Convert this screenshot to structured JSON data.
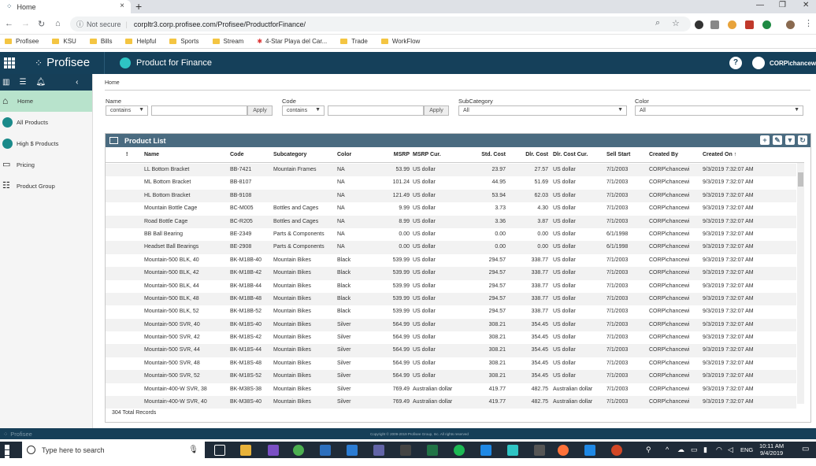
{
  "browser": {
    "tab_title": "Home",
    "security_label": "Not secure",
    "url": "corpltr3.corp.profisee.com/Profisee/ProductforFinance/",
    "bookmarks": [
      "Profisee",
      "KSU",
      "Bills",
      "Helpful",
      "Sports",
      "Stream",
      "4-Star Playa del Car...",
      "Trade",
      "WorkFlow"
    ]
  },
  "app": {
    "brand": "Profisee",
    "app_name": "Product for Finance",
    "help": "?",
    "user": "CORP\\chancewi"
  },
  "sidebar": {
    "items": [
      {
        "label": "Home"
      },
      {
        "label": "All Products"
      },
      {
        "label": "High $ Products"
      },
      {
        "label": "Pricing"
      },
      {
        "label": "Product Group"
      }
    ]
  },
  "breadcrumb": "Home",
  "filters": {
    "name": {
      "label": "Name",
      "op": "contains",
      "apply": "Apply"
    },
    "code": {
      "label": "Code",
      "op": "contains",
      "apply": "Apply"
    },
    "subcategory": {
      "label": "SubCategory",
      "value": "All"
    },
    "color": {
      "label": "Color",
      "value": "All"
    }
  },
  "list": {
    "title": "Product List",
    "columns": {
      "flag": "!",
      "name": "Name",
      "code": "Code",
      "subcategory": "Subcategory",
      "color": "Color",
      "msrp": "MSRP",
      "msrp_cur": "MSRP Cur.",
      "std_cost": "Std. Cost",
      "dlr_cost": "Dlr. Cost",
      "dlr_cost_cur": "Dlr. Cost Cur.",
      "sell_start": "Sell Start",
      "created_by": "Created By",
      "created_on": "Created On"
    },
    "rows": [
      [
        "LL Bottom Bracket",
        "BB-7421",
        "Mountain Frames",
        "NA",
        "53.99",
        "US dollar",
        "23.97",
        "27.57",
        "US dollar",
        "7/1/2003",
        "CORP\\chancewi",
        "9/3/2019 7:32:07 AM"
      ],
      [
        "ML Bottom Bracket",
        "BB-8107",
        "",
        "NA",
        "101.24",
        "US dollar",
        "44.95",
        "51.69",
        "US dollar",
        "7/1/2003",
        "CORP\\chancewi",
        "9/3/2019 7:32:07 AM"
      ],
      [
        "HL Bottom Bracket",
        "BB-9108",
        "",
        "NA",
        "121.49",
        "US dollar",
        "53.94",
        "62.03",
        "US dollar",
        "7/1/2003",
        "CORP\\chancewi",
        "9/3/2019 7:32:07 AM"
      ],
      [
        "Mountain Bottle Cage",
        "BC-M005",
        "Bottles and Cages",
        "NA",
        "9.99",
        "US dollar",
        "3.73",
        "4.30",
        "US dollar",
        "7/1/2003",
        "CORP\\chancewi",
        "9/3/2019 7:32:07 AM"
      ],
      [
        "Road Bottle Cage",
        "BC-R205",
        "Bottles and Cages",
        "NA",
        "8.99",
        "US dollar",
        "3.36",
        "3.87",
        "US dollar",
        "7/1/2003",
        "CORP\\chancewi",
        "9/3/2019 7:32:07 AM"
      ],
      [
        "BB Ball Bearing",
        "BE-2349",
        "Parts & Components",
        "NA",
        "0.00",
        "US dollar",
        "0.00",
        "0.00",
        "US dollar",
        "6/1/1998",
        "CORP\\chancewi",
        "9/3/2019 7:32:07 AM"
      ],
      [
        "Headset Ball Bearings",
        "BE-2908",
        "Parts & Components",
        "NA",
        "0.00",
        "US dollar",
        "0.00",
        "0.00",
        "US dollar",
        "6/1/1998",
        "CORP\\chancewi",
        "9/3/2019 7:32:07 AM"
      ],
      [
        "Mountain-500 BLK, 40",
        "BK-M18B-40",
        "Mountain Bikes",
        "Black",
        "539.99",
        "US dollar",
        "294.57",
        "338.77",
        "US dollar",
        "7/1/2003",
        "CORP\\chancewi",
        "9/3/2019 7:32:07 AM"
      ],
      [
        "Mountain-500 BLK, 42",
        "BK-M18B-42",
        "Mountain Bikes",
        "Black",
        "539.99",
        "US dollar",
        "294.57",
        "338.77",
        "US dollar",
        "7/1/2003",
        "CORP\\chancewi",
        "9/3/2019 7:32:07 AM"
      ],
      [
        "Mountain-500 BLK, 44",
        "BK-M18B-44",
        "Mountain Bikes",
        "Black",
        "539.99",
        "US dollar",
        "294.57",
        "338.77",
        "US dollar",
        "7/1/2003",
        "CORP\\chancewi",
        "9/3/2019 7:32:07 AM"
      ],
      [
        "Mountain-500 BLK, 48",
        "BK-M18B-48",
        "Mountain Bikes",
        "Black",
        "539.99",
        "US dollar",
        "294.57",
        "338.77",
        "US dollar",
        "7/1/2003",
        "CORP\\chancewi",
        "9/3/2019 7:32:07 AM"
      ],
      [
        "Mountain-500 BLK, 52",
        "BK-M18B-52",
        "Mountain Bikes",
        "Black",
        "539.99",
        "US dollar",
        "294.57",
        "338.77",
        "US dollar",
        "7/1/2003",
        "CORP\\chancewi",
        "9/3/2019 7:32:07 AM"
      ],
      [
        "Mountain-500 SVR, 40",
        "BK-M18S-40",
        "Mountain Bikes",
        "Silver",
        "564.99",
        "US dollar",
        "308.21",
        "354.45",
        "US dollar",
        "7/1/2003",
        "CORP\\chancewi",
        "9/3/2019 7:32:07 AM"
      ],
      [
        "Mountain-500 SVR, 42",
        "BK-M18S-42",
        "Mountain Bikes",
        "Silver",
        "564.99",
        "US dollar",
        "308.21",
        "354.45",
        "US dollar",
        "7/1/2003",
        "CORP\\chancewi",
        "9/3/2019 7:32:07 AM"
      ],
      [
        "Mountain-500 SVR, 44",
        "BK-M18S-44",
        "Mountain Bikes",
        "Silver",
        "564.99",
        "US dollar",
        "308.21",
        "354.45",
        "US dollar",
        "7/1/2003",
        "CORP\\chancewi",
        "9/3/2019 7:32:07 AM"
      ],
      [
        "Mountain-500 SVR, 48",
        "BK-M18S-48",
        "Mountain Bikes",
        "Silver",
        "564.99",
        "US dollar",
        "308.21",
        "354.45",
        "US dollar",
        "7/1/2003",
        "CORP\\chancewi",
        "9/3/2019 7:32:07 AM"
      ],
      [
        "Mountain-500 SVR, 52",
        "BK-M18S-52",
        "Mountain Bikes",
        "Silver",
        "564.99",
        "US dollar",
        "308.21",
        "354.45",
        "US dollar",
        "7/1/2003",
        "CORP\\chancewi",
        "9/3/2019 7:32:07 AM"
      ],
      [
        "Mountain-400-W SVR, 38",
        "BK-M38S-38",
        "Mountain Bikes",
        "Silver",
        "769.49",
        "Australian dollar",
        "419.77",
        "482.75",
        "Australian dollar",
        "7/1/2003",
        "CORP\\chancewi",
        "9/3/2019 7:32:07 AM"
      ],
      [
        "Mountain-400-W SVR, 40",
        "BK-M38S-40",
        "Mountain Bikes",
        "Silver",
        "769.49",
        "Australian dollar",
        "419.77",
        "482.75",
        "Australian dollar",
        "7/1/2003",
        "CORP\\chancewi",
        "9/3/2019 7:32:07 AM"
      ]
    ],
    "total": "304 Total Records"
  },
  "footer": {
    "brand": "Profisee",
    "copyright": "Copyright © 2009-2019 Profisee Group, Inc. All rights reserved"
  },
  "taskbar": {
    "search_placeholder": "Type here to search",
    "lang": "ENG",
    "time": "10:11 AM",
    "date": "9/4/2019"
  }
}
